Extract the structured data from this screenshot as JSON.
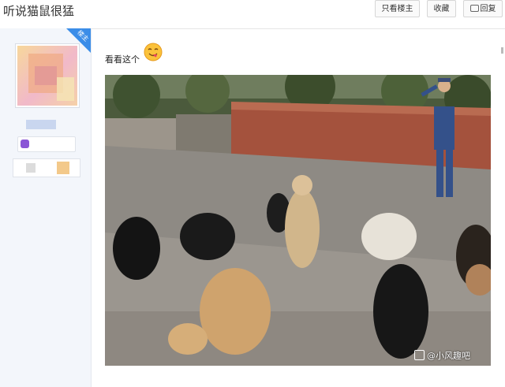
{
  "header": {
    "thread_title": "听说猫鼠很猛",
    "only_author_label": "只看楼主",
    "collect_label": "收藏",
    "reply_label": "回复"
  },
  "sidebar": {
    "author_badge": "楼主"
  },
  "post": {
    "text": "看看这个",
    "emoji": "tongue-out-emoji-icon",
    "image": {
      "description_icon": "dogs-training-photo",
      "watermark": "@小风趣吧"
    }
  }
}
